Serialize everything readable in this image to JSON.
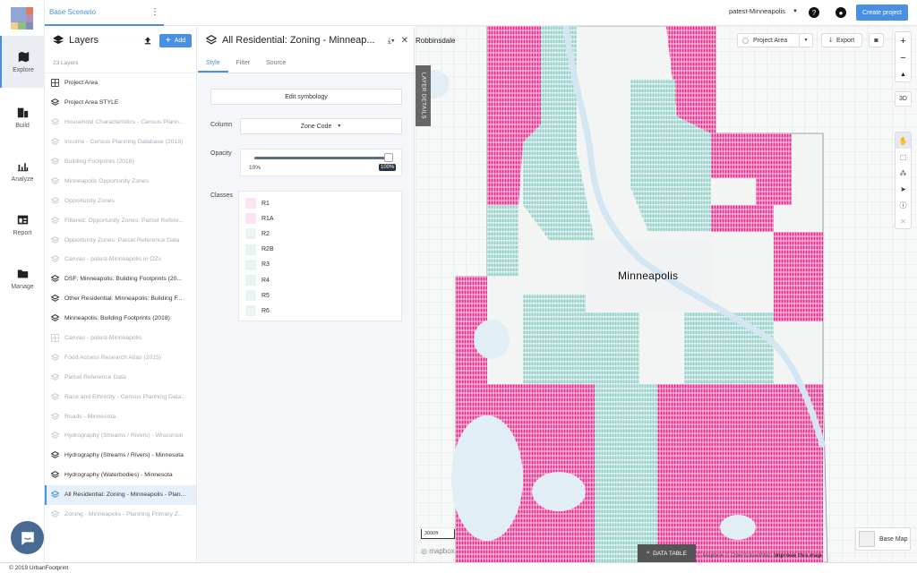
{
  "app": {
    "scenario": "Base Scenario",
    "project": "patest-Minneapolis",
    "create_project": "Create project",
    "copyright": "© 2019 UrbanFootprint"
  },
  "nav": [
    {
      "label": "Explore",
      "icon": "map-icon",
      "active": true
    },
    {
      "label": "Build",
      "icon": "buildings-icon"
    },
    {
      "label": "Analyze",
      "icon": "bar-chart-icon"
    },
    {
      "label": "Report",
      "icon": "report-icon"
    },
    {
      "label": "Manage",
      "icon": "folder-edit-icon"
    }
  ],
  "layers_panel": {
    "title": "Layers",
    "add_label": "Add",
    "count": "23 Layers",
    "items": [
      {
        "label": "Project Area",
        "state": "on",
        "icon": "grid"
      },
      {
        "label": "Project Area STYLE",
        "state": "on",
        "icon": "layers"
      },
      {
        "label": "Household Characteristics - Census Plann...",
        "state": "off",
        "icon": "layers"
      },
      {
        "label": "Income - Census Planning Database (2018)",
        "state": "off",
        "icon": "layers"
      },
      {
        "label": "Building Footprints (2018)",
        "state": "off",
        "icon": "layers"
      },
      {
        "label": "Minneapolis Opportunity Zones",
        "state": "off",
        "icon": "layers"
      },
      {
        "label": "Opportunity Zones",
        "state": "off",
        "icon": "layers"
      },
      {
        "label": "Filtered: Opportunity Zones: Parcel Refere...",
        "state": "off",
        "icon": "layers"
      },
      {
        "label": "Opportunity Zones: Parcel Reference Data",
        "state": "off",
        "icon": "layers"
      },
      {
        "label": "Canvas - patest-Minneapolis in OZs",
        "state": "off",
        "icon": "layers"
      },
      {
        "label": "DSF: Minneapolis: Building Footprints (20...",
        "state": "on",
        "icon": "layers"
      },
      {
        "label": "Other Residential: Minneapolis: Building F...",
        "state": "on",
        "icon": "layers"
      },
      {
        "label": "Minneapolis: Building Footprints (2018)",
        "state": "on",
        "icon": "layers"
      },
      {
        "label": "Canvas - patest-Minneapolis",
        "state": "off",
        "icon": "grid"
      },
      {
        "label": "Food Access Research Atlas (2015)",
        "state": "off",
        "icon": "layers"
      },
      {
        "label": "Parcel Reference Data",
        "state": "off",
        "icon": "layers"
      },
      {
        "label": "Race and Ethnicity - Census Planning Data...",
        "state": "off",
        "icon": "layers"
      },
      {
        "label": "Roads - Minnesota",
        "state": "off",
        "icon": "layers"
      },
      {
        "label": "Hydrography (Streams / Rivers) - Wisconsin",
        "state": "off",
        "icon": "layers"
      },
      {
        "label": "Hydrography (Streams / Rivers) - Minnesota",
        "state": "on",
        "icon": "layers"
      },
      {
        "label": "Hydrography (Waterbodies) - Minnesota",
        "state": "on",
        "icon": "layers"
      },
      {
        "label": "All Residential: Zoning - Minneapolis - Plan...",
        "state": "selected",
        "icon": "layers"
      },
      {
        "label": "Zoning - Minneapolis - Planning Primary Z...",
        "state": "off",
        "icon": "layers"
      }
    ]
  },
  "details_panel": {
    "title": "All Residential: Zoning - Minneap...",
    "tabs": [
      "Style",
      "Filter",
      "Source"
    ],
    "active_tab": "Style",
    "edit_symbology": "Edit symbology",
    "column_label": "Column",
    "column_value": "Zone Code",
    "opacity_label": "Opacity",
    "opacity_min": "10%",
    "opacity_value": "100%",
    "opacity_fraction": 1.0,
    "classes_label": "Classes",
    "classes": [
      {
        "name": "R1",
        "color": "#fbe3f0"
      },
      {
        "name": "R1A",
        "color": "#fbe3f0"
      },
      {
        "name": "R2",
        "color": "#eaf5f3"
      },
      {
        "name": "R2B",
        "color": "#eaf5f3"
      },
      {
        "name": "R3",
        "color": "#eaf5f3"
      },
      {
        "name": "R4",
        "color": "#eaf5f3"
      },
      {
        "name": "R5",
        "color": "#eaf5f3"
      },
      {
        "name": "R6",
        "color": "#eaf5f3"
      }
    ]
  },
  "map": {
    "layer_details_tab": "LAYER DETAILS",
    "project_area": "Project Area",
    "export": "Export",
    "three_d": "3D",
    "city_label": "Minneapolis",
    "place_label": "Robbinsdale",
    "scale": "3000ft",
    "data_table": "DATA TABLE",
    "base_map": "Base Map",
    "attribution": "© Mapbox © OpenStreetMap",
    "improve": "Improve this map",
    "mapbox_logo": "mapbox",
    "colors": {
      "pink": "#e8238a",
      "pink_light": "#fbd8ea",
      "teal": "#8fcfc8",
      "teal_light": "#e3f2ef",
      "water": "#e1eef6"
    }
  },
  "colors": {
    "accent": "#4a90e2"
  }
}
